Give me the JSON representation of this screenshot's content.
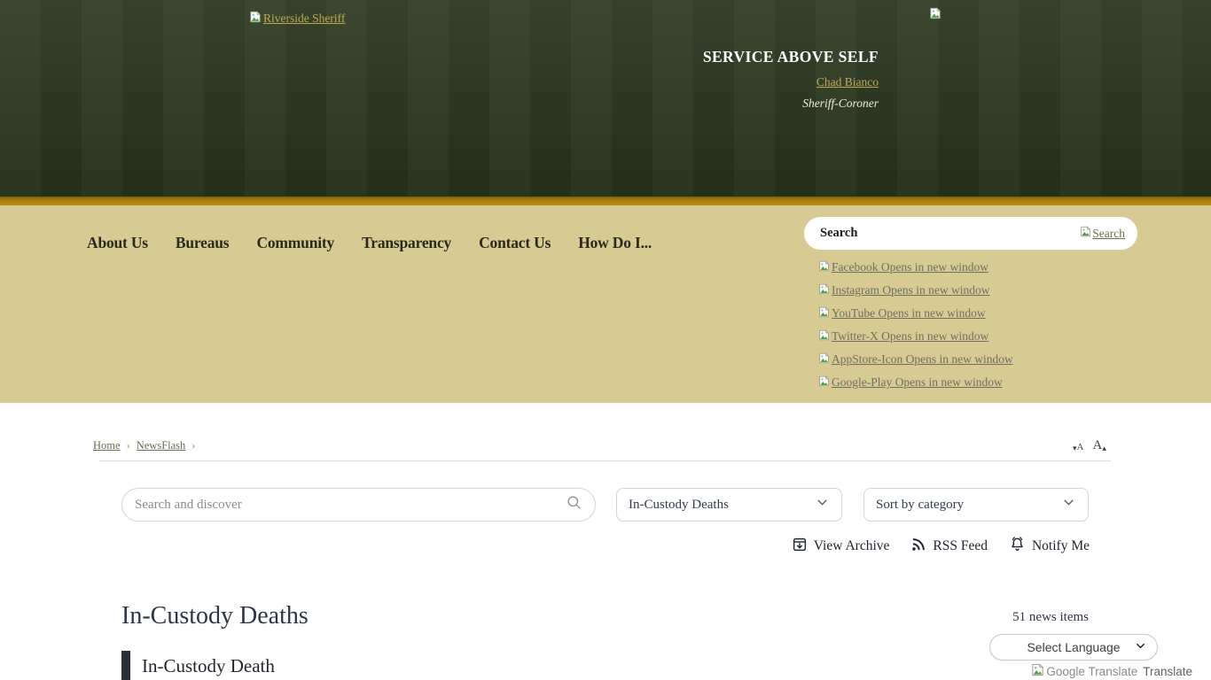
{
  "colors": {
    "header_green": "#2d3921",
    "gold_stripe": "#b98f10",
    "tan_band": "#d8ca93",
    "header_link_gold": "#c2a855",
    "muted_link": "#6d7060",
    "heading_navy": "#2e3547"
  },
  "header": {
    "logo_alt": "Riverside Sheriff",
    "motto": "SERVICE ABOVE SELF",
    "sheriff_name": "Chad Bianco",
    "sheriff_title": "Sheriff-Coroner"
  },
  "nav": {
    "items": [
      {
        "label": "About Us"
      },
      {
        "label": "Bureaus"
      },
      {
        "label": "Community"
      },
      {
        "label": "Transparency"
      },
      {
        "label": "Contact Us"
      },
      {
        "label": "How Do I..."
      }
    ],
    "search_placeholder": "Search",
    "search_button": "Search"
  },
  "social": {
    "links": [
      {
        "label": "Facebook Opens in new window"
      },
      {
        "label": "Instagram Opens in new window"
      },
      {
        "label": "YouTube Opens in new window"
      },
      {
        "label": "Twitter-X Opens in new window"
      },
      {
        "label": "AppStore-Icon Opens in new window"
      },
      {
        "label": "Google-Play Opens in new window"
      }
    ]
  },
  "breadcrumb": {
    "home": "Home",
    "separator": "›",
    "newsflash": "NewsFlash"
  },
  "font_controls": {
    "decrease_triangle": "▾",
    "decrease_letter": "A",
    "increase_letter": "A",
    "increase_triangle": "▴"
  },
  "filters": {
    "search_placeholder": "Search and discover",
    "category_selected": "In-Custody Deaths",
    "sort_selected": "Sort by category"
  },
  "actions": {
    "view_archive": "View Archive",
    "rss_feed": "RSS Feed",
    "notify_me": "Notify Me"
  },
  "content": {
    "page_title": "In-Custody Deaths",
    "news_count": "51 news items",
    "language_selected": "Select Language",
    "translate_alt": "Google Translate",
    "translate_label": "Translate",
    "section_title": "In-Custody Death"
  }
}
